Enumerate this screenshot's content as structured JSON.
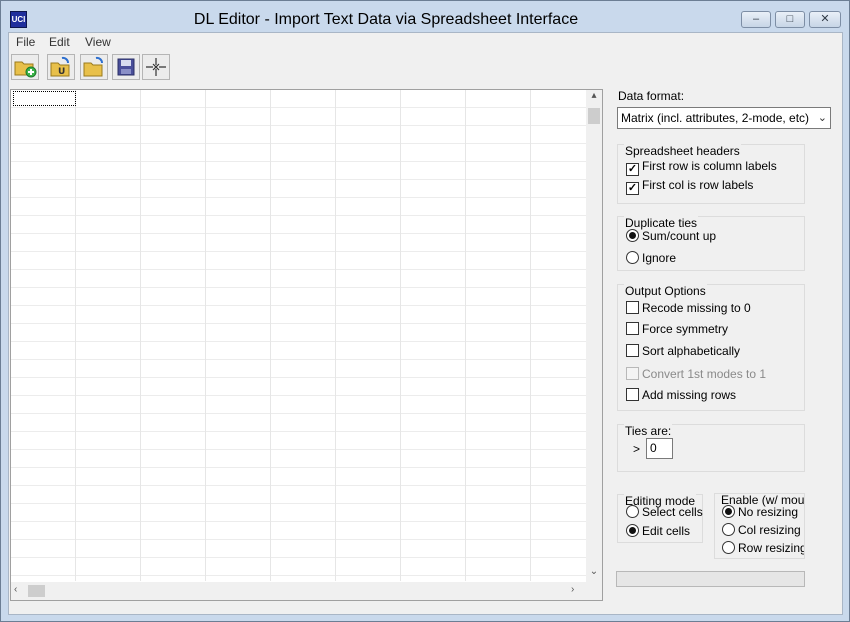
{
  "window": {
    "app_icon": "UCI",
    "title": "DL Editor - Import Text Data via Spreadsheet Interface",
    "controls": {
      "minimize": "minimize-icon",
      "maximize": "maximize-icon",
      "close": "close-icon"
    }
  },
  "menu": {
    "file": "File",
    "edit": "Edit",
    "view": "View"
  },
  "toolbar": {
    "icons": [
      "new-folder-icon",
      "import-u-icon",
      "open-folder-icon",
      "save-icon",
      "collapse-icon"
    ]
  },
  "data_format": {
    "label": "Data format:",
    "selected": "Matrix (incl. attributes, 2-mode, etc)"
  },
  "spreadsheet_headers": {
    "title": "Spreadsheet headers",
    "first_row": {
      "label": "First row is column labels",
      "checked": true
    },
    "first_col": {
      "label": "First col is row labels",
      "checked": true
    }
  },
  "duplicate_ties": {
    "title": "Duplicate ties",
    "sum": {
      "label": "Sum/count up",
      "selected": true
    },
    "ignore": {
      "label": "Ignore",
      "selected": false
    }
  },
  "output_options": {
    "title": "Output Options",
    "recode": {
      "label": "Recode missing to 0",
      "checked": false
    },
    "force_symmetry": {
      "label": "Force symmetry",
      "checked": false
    },
    "sort_alpha": {
      "label": "Sort alphabetically",
      "checked": false
    },
    "convert_modes": {
      "label": "Convert 1st modes to 1",
      "checked": false,
      "disabled": true
    },
    "add_missing": {
      "label": "Add missing rows",
      "checked": false
    }
  },
  "ties_are": {
    "title": "Ties are:",
    "operator": ">",
    "value": "0"
  },
  "editing_mode": {
    "title": "Editing mode",
    "select_cells": {
      "label": "Select cells",
      "selected": false
    },
    "edit_cells": {
      "label": "Edit cells",
      "selected": true
    }
  },
  "enable": {
    "title": "Enable (w/ mouse",
    "no_resizing": {
      "label": "No resizing",
      "selected": true
    },
    "col_resizing": {
      "label": "Col resizing",
      "selected": false
    },
    "row_resizing": {
      "label": "Row resizing",
      "selected": false
    }
  },
  "colors": {
    "window_frame": "#c9d9ec",
    "client_bg": "#f0f0f0",
    "grid_line": "#e6e6e6"
  }
}
